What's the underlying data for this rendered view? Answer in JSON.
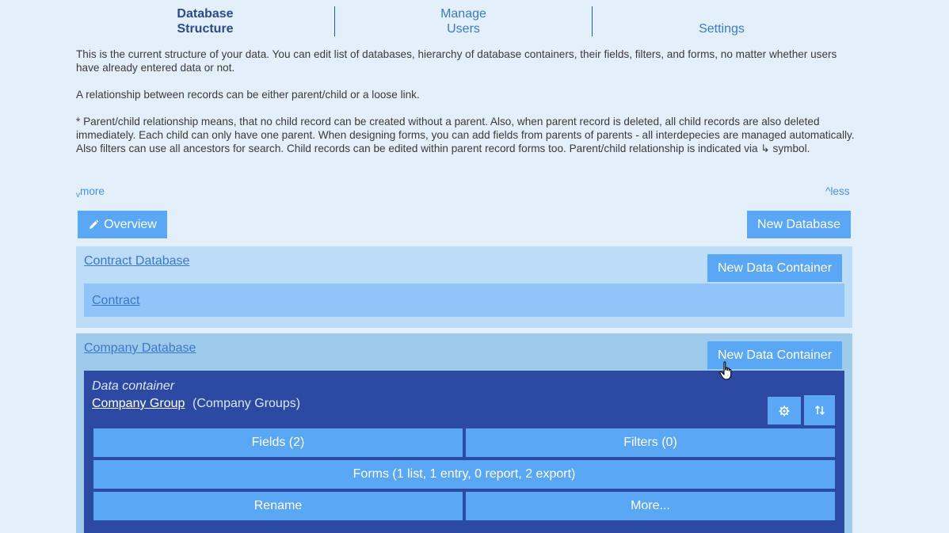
{
  "tabs": [
    {
      "line1": "Database",
      "line2": "Structure",
      "active": true
    },
    {
      "line1": "Manage",
      "line2": "Users",
      "active": false
    },
    {
      "line1": "",
      "line2": "Settings",
      "active": false
    }
  ],
  "description": {
    "p1": "This is the current structure of your data. You can edit list of databases, hierarchy of database containers, their fields, filters, and forms, no matter whether users have already entered data or not.",
    "p2": "A relationship between records can be either parent/child or a loose link.",
    "p3": "* Parent/child relationship means, that no child record can be created without a parent. Also, when parent record is deleted, all child records are also deleted immediately. Each child can only have one parent. When designing forms, you can add fields from parents of parents - all interdepecies are managed automatically. Also filters can use all ancestors for search. Child records can be edited within parent record forms too. Parent/child relationship is indicated via ↳ symbol."
  },
  "toggles": {
    "more": "more",
    "more_symbol": "v",
    "less": "less",
    "less_symbol": "^"
  },
  "toolbar": {
    "overview_label": "Overview",
    "new_database_label": "New Database"
  },
  "databases": [
    {
      "name": "Contract Database",
      "new_container_label": "New Data Container",
      "containers": [
        {
          "name": "Contract"
        }
      ]
    },
    {
      "name": "Company Database",
      "new_container_label": "New Data Container",
      "data_container": {
        "label": "Data container",
        "name": "Company Group",
        "plural": "(Company Groups)",
        "fields_label": "Fields (2)",
        "filters_label": "Filters (0)",
        "forms_label": "Forms (1 list, 1 entry, 0 report, 2 export)",
        "rename_label": "Rename",
        "more_label": "More..."
      }
    }
  ],
  "colors": {
    "page_bg": "#e3f0fb",
    "button": "#59a7f5",
    "panel_dark": "#2d4aa3",
    "link": "#3a78c9"
  }
}
